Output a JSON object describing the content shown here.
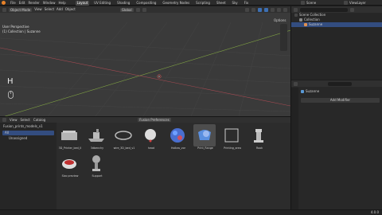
{
  "topbar": {
    "menus": [
      "File",
      "Edit",
      "Render",
      "Window",
      "Help"
    ],
    "tabs": [
      "Layout",
      "UV Editing",
      "Shading",
      "Compositing",
      "Geometry Nodes",
      "Scripting",
      "Sheet",
      "Sky",
      "Fix"
    ],
    "scene_label": "Scene",
    "view_layer_label": "ViewLayer"
  },
  "viewport": {
    "mode": "Object Mode",
    "menus": [
      "View",
      "Select",
      "Add",
      "Object"
    ],
    "transform": "Global",
    "options": "Options",
    "view_name": "User Perspective",
    "collection_info": "(1) Collection | Suzanne",
    "overlay_key": "H"
  },
  "outliner": {
    "search_placeholder": "",
    "rows": [
      {
        "label": "Scene Collection",
        "indent": 0
      },
      {
        "label": "Collection",
        "indent": 1
      },
      {
        "label": "Suzanne",
        "indent": 2
      }
    ]
  },
  "properties": {
    "object_name": "Suzanne",
    "add_modifier": "Add Modifier"
  },
  "asset_browser": {
    "menus": [
      "View",
      "Select",
      "Catalog"
    ],
    "library": "Fusion_prints_models_v1",
    "library_selector": "Fusion Preferences",
    "catalog_all": "All",
    "catalog_unassigned": "Unassigned",
    "assets": [
      {
        "name": "3D_Printer_bed_II"
      },
      {
        "name": "3dbenchy"
      },
      {
        "name": "wire_3D_bed_v1"
      },
      {
        "name": "head"
      },
      {
        "name": "Hollow_vor"
      },
      {
        "name": "Print_Range"
      },
      {
        "name": "Printing_area"
      },
      {
        "name": "Rook"
      },
      {
        "name": "Sizo preview"
      },
      {
        "name": "Support"
      }
    ]
  },
  "statusbar": {
    "version": "4.0.0"
  }
}
